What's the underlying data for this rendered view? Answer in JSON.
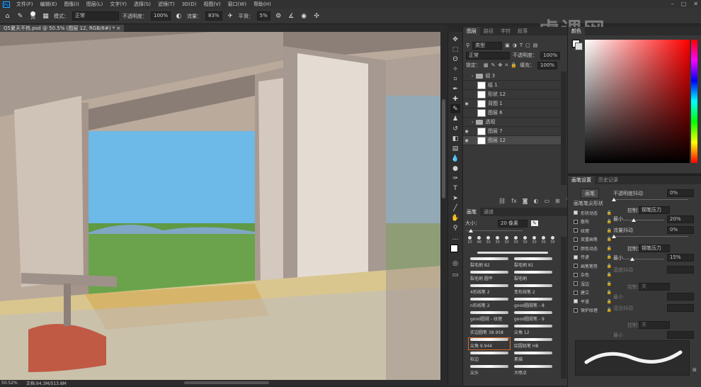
{
  "menu": {
    "app_icon": "Ps",
    "items": [
      "文件(F)",
      "编辑(E)",
      "图像(I)",
      "图层(L)",
      "文字(Y)",
      "选择(S)",
      "滤镜(T)",
      "3D(D)",
      "视图(V)",
      "窗口(W)",
      "帮助(H)"
    ]
  },
  "options": {
    "brush_size": "20",
    "mode_label": "模式：",
    "mode_value": "正常",
    "opacity_label": "不透明度：",
    "opacity_value": "100%",
    "flow_label": "流量：",
    "flow_value": "83%",
    "smooth_label": "平滑：",
    "smooth_value": "5%"
  },
  "document": {
    "tab_title": "Q5夏天不热.psd @ 50.5% (图层 12, RGB/8#) *",
    "zoom": "50.52%",
    "doc_info": "文档:94.3M/513.8M"
  },
  "layers_panel": {
    "tabs": [
      "图层",
      "路径",
      "字符",
      "段落"
    ],
    "kind_label": "类型",
    "blend_mode": "正常",
    "opacity_label": "不透明度：",
    "opacity_value": "100%",
    "lock_label": "锁定：",
    "fill_label": "填充：",
    "fill_value": "100%",
    "layers": [
      {
        "name": "组 3",
        "type": "folder",
        "visible": false,
        "selected": false
      },
      {
        "name": "组 1",
        "type": "layer",
        "visible": false,
        "selected": false
      },
      {
        "name": "形状 12",
        "type": "layer",
        "visible": false,
        "selected": false
      },
      {
        "name": "背图 1",
        "type": "layer",
        "visible": true,
        "selected": false
      },
      {
        "name": "图层 6",
        "type": "layer",
        "visible": false,
        "selected": false
      },
      {
        "name": "透视",
        "type": "folder",
        "visible": false,
        "selected": false
      },
      {
        "name": "图层 7",
        "type": "layer",
        "visible": true,
        "selected": false
      },
      {
        "name": "图层 12",
        "type": "layer",
        "visible": true,
        "selected": true
      }
    ]
  },
  "brushes_panel": {
    "tabs": [
      "画笔",
      "通道"
    ],
    "size_label": "大小：",
    "size_value": "20 像素",
    "presets": [
      "20",
      "48",
      "30",
      "30",
      "30",
      "30",
      "30",
      "30",
      "30",
      "30"
    ],
    "brushes": [
      "裂毛刷 82",
      "裂毛刷 81",
      "裂毛刷 圆平",
      "裂毛刷",
      "4形线笔 2",
      "变形线笔 2",
      "n形线笔 2",
      "good圆规笔 - 8",
      "good圆规 - 纹理",
      "good圆规笔 - 9",
      "实边圆笔 38.958",
      "尖角 12",
      "尖角 9.944",
      "绘圆铅笔 HB",
      "软边",
      "素描",
      "尖头",
      "大喷点"
    ],
    "selected_brush": "尖角 9.944"
  },
  "color_panel": {
    "title": "颜色"
  },
  "brush_settings": {
    "tabs": [
      "画笔设置",
      "历史记录"
    ],
    "button": "画笔",
    "section": "画笔笔尖形状",
    "options": [
      {
        "label": "形状动态",
        "checked": true
      },
      {
        "label": "散布",
        "checked": false
      },
      {
        "label": "纹理",
        "checked": false
      },
      {
        "label": "双重画笔",
        "checked": false
      },
      {
        "label": "颜色动态",
        "checked": false
      },
      {
        "label": "传递",
        "checked": true
      },
      {
        "label": "画笔笔势",
        "checked": false
      },
      {
        "label": "杂色",
        "checked": false
      },
      {
        "label": "湿边",
        "checked": false
      },
      {
        "label": "建立",
        "checked": false
      },
      {
        "label": "平滑",
        "checked": true
      },
      {
        "label": "保护纹理",
        "checked": false
      }
    ],
    "opacity_jitter_label": "不透明度抖动",
    "opacity_jitter_value": "0%",
    "control_label": "控制：",
    "control_value_1": "钢笔压力",
    "min_label": "最小",
    "min_value_1": "20%",
    "flow_jitter_label": "流量抖动",
    "flow_jitter_value": "0%",
    "control_value_2": "钢笔压力",
    "min_value_2": "15%",
    "wet_jitter_label": "湿度抖动",
    "control_value_3": "关",
    "mix_jitter_label": "混合抖动",
    "control_value_4": "关"
  },
  "watermark": "虎课网"
}
